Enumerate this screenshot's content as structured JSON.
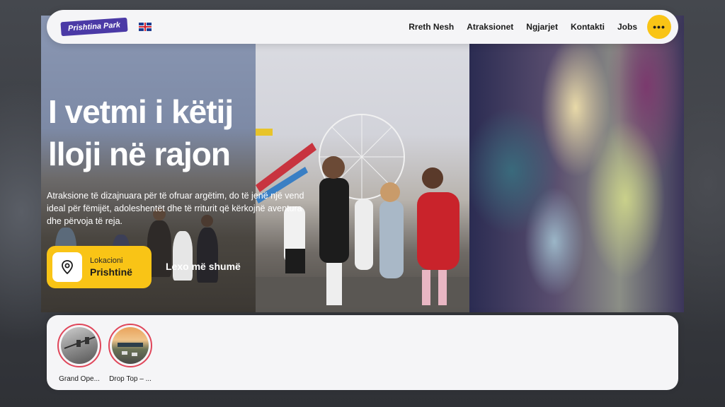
{
  "nav": {
    "logo_text": "Prishtina Park",
    "language_flag": "uk-flag-icon",
    "links": [
      "Rreth Nesh",
      "Atraksionet",
      "Ngjarjet",
      "Kontakti",
      "Jobs"
    ],
    "menu_symbol": "•••"
  },
  "hero": {
    "title_line1": "I vetmi i këtij",
    "title_line2": "lloji në rajon",
    "description": "Atraksione të dizajnuara për të ofruar argëtim, do të jenë një vend ideal për fëmijët, adoleshentët dhe të rriturit që kërkojnë aventura dhe përvoja të reja.",
    "location_label": "Lokacioni",
    "location_value": "Prishtinë",
    "location_icon": "map-pin-icon",
    "read_more": "Lexo më shumë"
  },
  "stories": [
    {
      "label": "Grand Ope..."
    },
    {
      "label": "Drop Top – ..."
    }
  ],
  "colors": {
    "accent_yellow": "#f9c416",
    "logo_purple": "#4b3aa6",
    "story_ring": "#e0465a"
  }
}
